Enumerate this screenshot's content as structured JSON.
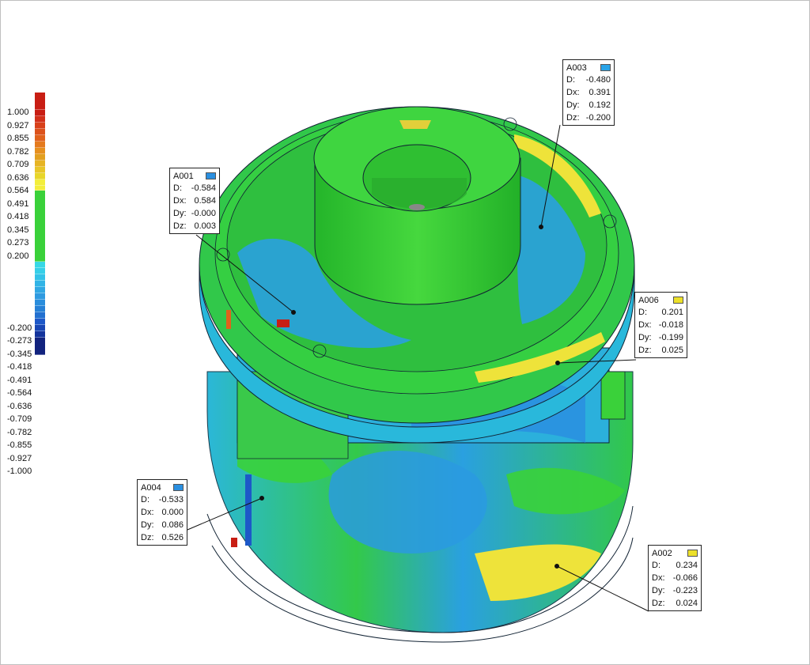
{
  "legend": {
    "labels": [
      "1.000",
      "0.927",
      "0.855",
      "0.782",
      "0.709",
      "0.636",
      "0.564",
      "0.491",
      "0.418",
      "0.345",
      "0.273",
      "0.200",
      "-0.200",
      "-0.273",
      "-0.345",
      "-0.418",
      "-0.491",
      "-0.564",
      "-0.636",
      "-0.709",
      "-0.782",
      "-0.855",
      "-0.927",
      "-1.000"
    ],
    "colors": {
      "max": "#c81e14",
      "high": "#e0621c",
      "mid_high": "#e2a020",
      "warm": "#e8d62a",
      "yellow": "#f3ee3b",
      "in_tolerance": "#3ad13a",
      "low_start": "#37d8e6",
      "low_mid": "#2f9ae0",
      "low": "#1d58c8",
      "min": "#12237e"
    }
  },
  "callouts": [
    {
      "id": "A001",
      "swatch": "#2a8fe0",
      "d": "-0.584",
      "dx": "0.584",
      "dy": "-0.000",
      "dz": "0.003"
    },
    {
      "id": "A003",
      "swatch": "#2aa4e8",
      "d": "-0.480",
      "dx": "0.391",
      "dy": "0.192",
      "dz": "-0.200"
    },
    {
      "id": "A006",
      "swatch": "#ece02a",
      "d": "0.201",
      "dx": "-0.018",
      "dy": "-0.199",
      "dz": "0.025"
    },
    {
      "id": "A004",
      "swatch": "#2a8fe0",
      "d": "-0.533",
      "dx": "0.000",
      "dy": "0.086",
      "dz": "0.526"
    },
    {
      "id": "A002",
      "swatch": "#ece02a",
      "d": "0.234",
      "dx": "-0.066",
      "dy": "-0.223",
      "dz": "0.024"
    }
  ],
  "row_keys": {
    "d": "D:",
    "dx": "Dx:",
    "dy": "Dy:",
    "dz": "Dz:"
  }
}
